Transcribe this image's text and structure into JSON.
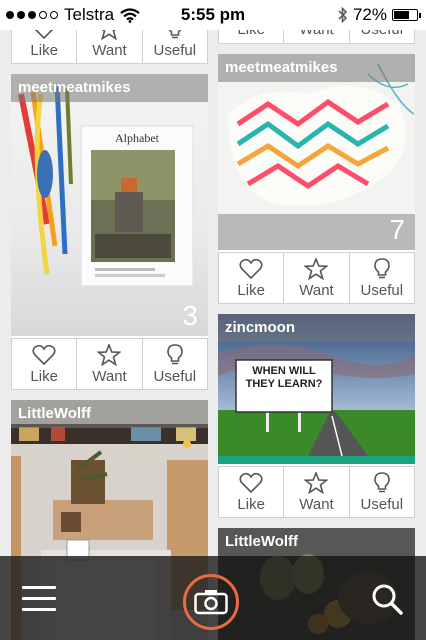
{
  "status": {
    "carrier": "Telstra",
    "time": "5:55 pm",
    "battery": "72%",
    "battery_level": 0.72
  },
  "actions": {
    "like": "Like",
    "want": "Want",
    "useful": "Useful"
  },
  "posts": {
    "left_top": {
      "username": "meetmeatmikes",
      "count": "3"
    },
    "left_bottom": {
      "username": "LittleWolff"
    },
    "right_top": {
      "username": "meetmeatmikes",
      "count": "7"
    },
    "right_mid": {
      "username": "zincmoon"
    },
    "right_bottom": {
      "username": "LittleWolff"
    }
  },
  "photos": {
    "magazine_title": "Alphabet",
    "billboard_text": "WHEN WILL THEY LEARN?"
  },
  "colors": {
    "accent": "#ea6a43",
    "teal": "#1aa37f"
  }
}
